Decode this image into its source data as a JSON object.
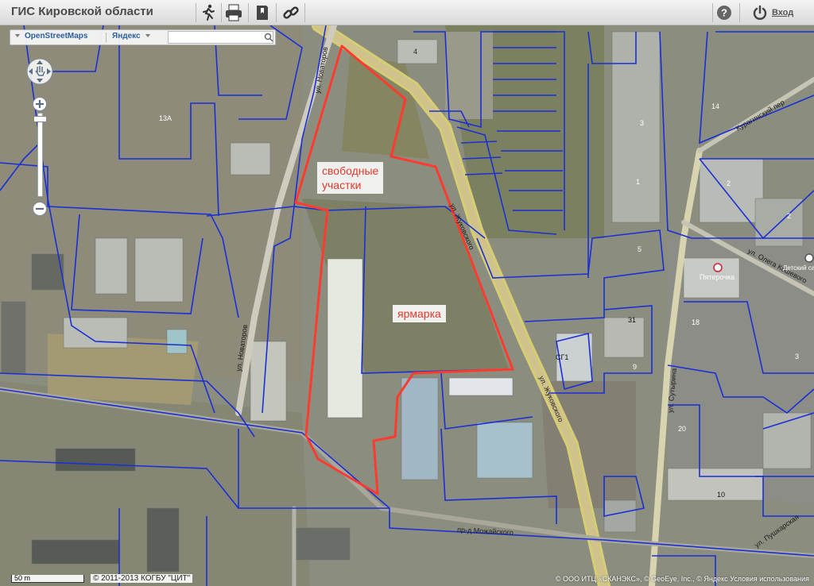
{
  "app": {
    "title": "ГИС Кировской области"
  },
  "toolbar": {
    "icons": [
      "runner-icon",
      "print-icon",
      "bookmark-icon",
      "link-icon"
    ],
    "help_label": "?",
    "logout_label": "Вход"
  },
  "layers": {
    "tab1": "OpenStreetMaps",
    "tab2": "Яндекс",
    "search_placeholder": ""
  },
  "annotations": {
    "free_plots": [
      "свободные",
      "участки"
    ],
    "fair": "ярмарка"
  },
  "streets": {
    "zhukovskogo_1": "ул. Жуковского",
    "zhukovskogo_2": "ул. Жуковского",
    "novatorov": "ул. Новаторов",
    "mozhayskogo": "пр-д Можайского",
    "kuraginsky": "Курагинский пер",
    "koshevogo": "ул. Олега Кошевого",
    "sutyrina": "ул. Сутырина",
    "bottom_right": "ул. Пушкарская"
  },
  "poi": {
    "pyaterochka": "Пятерочка",
    "kindergarten": "Детский са"
  },
  "house_numbers": [
    "13А",
    "4",
    "14",
    "2",
    "3",
    "1",
    "2",
    "3",
    "5",
    "31",
    "9",
    "18",
    "20",
    "10",
    "СГ1"
  ],
  "footer": {
    "scale": "50 m",
    "copyright": "© 2011-2013 КОГБУ \"ЦИТ\"",
    "provider": "© ООО ИТЦ «СКАНЭКС», © GeoEye, Inc., © Яндекс  Условия использования"
  },
  "colors": {
    "parcel_line": "#1a2fd6",
    "highlight": "#ff3b30",
    "road": "#d9cf6a"
  }
}
